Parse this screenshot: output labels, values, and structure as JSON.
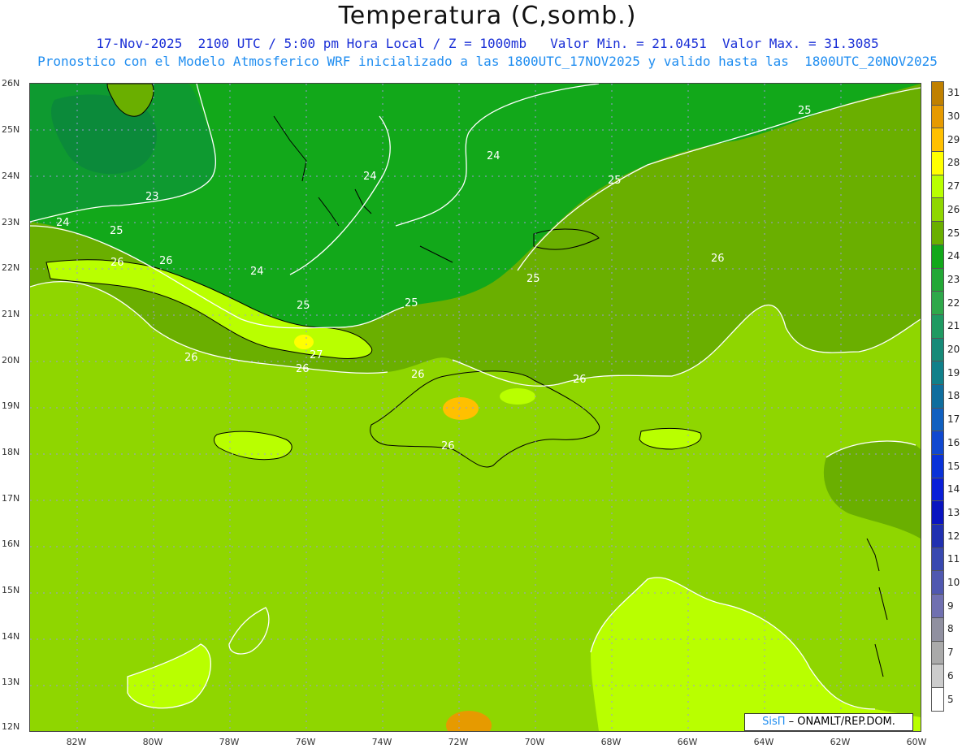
{
  "header": {
    "title": "Temperatura (C,somb.)",
    "line1": "17-Nov-2025  2100 UTC / 5:00 pm Hora Local / Z = 1000mb   Valor Min. = 21.0451  Valor Max. = 31.3085",
    "line2": "Pronostico con el Modelo Atmosferico WRF inicializado a las 1800UTC_17NOV2025 y valido hasta las  1800UTC_20NOV2025"
  },
  "axes": {
    "lat_labels": [
      "26N",
      "25N",
      "24N",
      "23N",
      "22N",
      "21N",
      "20N",
      "19N",
      "18N",
      "17N",
      "16N",
      "15N",
      "14N",
      "13N",
      "12N"
    ],
    "lon_labels": [
      "82W",
      "80W",
      "78W",
      "76W",
      "74W",
      "72W",
      "70W",
      "68W",
      "66W",
      "64W",
      "62W",
      "60W"
    ]
  },
  "colorbar": {
    "labels": [
      "31",
      "30",
      "29",
      "28",
      "27",
      "26",
      "25",
      "24",
      "23",
      "22",
      "21",
      "20",
      "19",
      "18",
      "17",
      "16",
      "15",
      "14",
      "13",
      "12",
      "11",
      "10",
      "9",
      "8",
      "7",
      "6",
      "5"
    ],
    "colors": [
      "#c08000",
      "#e69a00",
      "#ffc000",
      "#ffff00",
      "#b9ff00",
      "#8fd600",
      "#6aaf00",
      "#12a81a",
      "#23a836",
      "#2fa84a",
      "#1f9a62",
      "#168a78",
      "#10808a",
      "#0f6e9e",
      "#1060c0",
      "#1048d0",
      "#0a32d8",
      "#0a1fd8",
      "#0a14c0",
      "#2030b0",
      "#3848b0",
      "#5058b0",
      "#7070b0",
      "#9090a0",
      "#aaaaaa",
      "#cccccc",
      "#ffffff"
    ]
  },
  "contours": {
    "labels": [
      "23",
      "24",
      "24",
      "24",
      "24",
      "25",
      "25",
      "25",
      "25",
      "25",
      "25",
      "26",
      "26",
      "26",
      "26",
      "26",
      "26",
      "26",
      "26",
      "27"
    ]
  },
  "credit": {
    "brand": "SisΠ",
    "text": " – ONAMLT/REP.DOM."
  },
  "colors": {
    "warm_ocean": "#8fd600",
    "mild": "#6aaf00",
    "cool": "#12a81a",
    "cold_core": "#0b8a3a",
    "hot_spot": "#b9ff00",
    "land_peak": "#ffc000",
    "coast": "#000000",
    "contour": "#ffffff",
    "grid": "#9a9ad8"
  }
}
